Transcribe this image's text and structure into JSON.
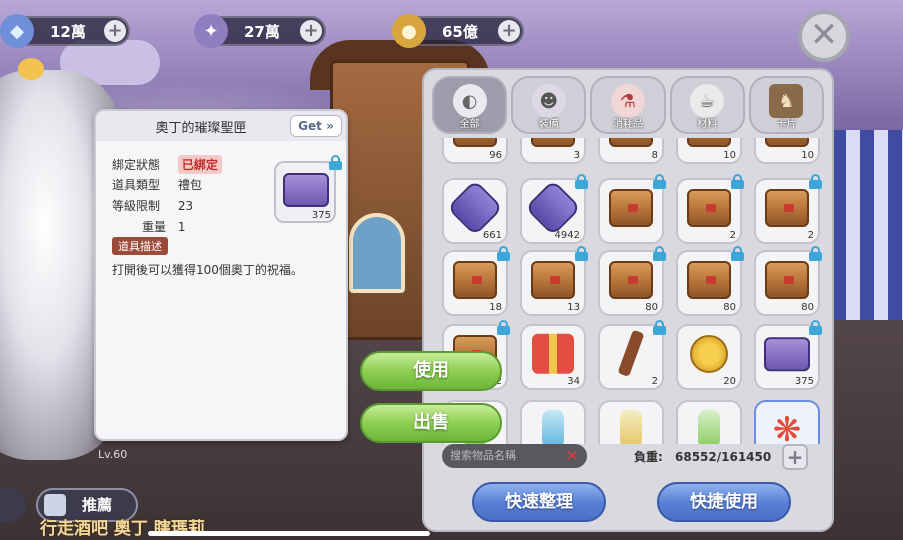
{
  "currencies": [
    {
      "icon": "diamond-icon",
      "value": "12萬"
    },
    {
      "icon": "feather-icon",
      "value": "27萬"
    },
    {
      "icon": "coin-icon",
      "value": "65億"
    }
  ],
  "tabs": [
    {
      "label": "全部",
      "icon": "all-icon",
      "active": true
    },
    {
      "label": "裝備",
      "icon": "equipment-icon",
      "active": false
    },
    {
      "label": "消耗品",
      "icon": "potion-icon",
      "active": false
    },
    {
      "label": "材料",
      "icon": "material-icon",
      "active": false
    },
    {
      "label": "卡片",
      "icon": "card-icon",
      "active": false
    }
  ],
  "inventory_rows": [
    [
      {
        "item": "partial-top",
        "qty": "96",
        "locked": false
      },
      {
        "item": "partial-top",
        "qty": "3",
        "locked": false
      },
      {
        "item": "partial-top",
        "qty": "8",
        "locked": false
      },
      {
        "item": "partial-top",
        "qty": "10",
        "locked": false
      },
      {
        "item": "partial-top",
        "qty": "10",
        "locked": false
      }
    ],
    [
      {
        "item": "purple-hexagon",
        "qty": "661",
        "locked": false
      },
      {
        "item": "purple-hexagon",
        "qty": "4942",
        "locked": true
      },
      {
        "item": "chest",
        "qty": "",
        "locked": true
      },
      {
        "item": "chest",
        "qty": "2",
        "locked": true
      },
      {
        "item": "chest",
        "qty": "2",
        "locked": true
      }
    ],
    [
      {
        "item": "chest",
        "qty": "18",
        "locked": true
      },
      {
        "item": "chest",
        "qty": "13",
        "locked": true
      },
      {
        "item": "chest",
        "qty": "80",
        "locked": true
      },
      {
        "item": "chest",
        "qty": "80",
        "locked": true
      },
      {
        "item": "chest",
        "qty": "80",
        "locked": true
      }
    ],
    [
      {
        "item": "chest",
        "qty": "2",
        "locked": true
      },
      {
        "item": "gift-box",
        "qty": "34",
        "locked": false
      },
      {
        "item": "branch",
        "qty": "2",
        "locked": true
      },
      {
        "item": "gold-coin",
        "qty": "20",
        "locked": false
      },
      {
        "item": "purple-chest",
        "qty": "375",
        "locked": true
      }
    ],
    [
      {
        "item": "bottle-green",
        "qty": "",
        "locked": false
      },
      {
        "item": "bottle-blue",
        "qty": "",
        "locked": false
      },
      {
        "item": "bottle-yellow",
        "qty": "",
        "locked": false
      },
      {
        "item": "bottle-green",
        "qty": "",
        "locked": false
      },
      {
        "item": "flame",
        "qty": "",
        "locked": false
      }
    ]
  ],
  "search": {
    "placeholder": "搜索物品名稱"
  },
  "weight": {
    "label": "負重:",
    "value": "68552/161450"
  },
  "buttons": {
    "sort": "快速整理",
    "quick_use": "快捷使用",
    "use": "使用",
    "sell": "出售"
  },
  "detail": {
    "title": "奧丁的璀璨聖匣",
    "get": "Get »",
    "bind_label": "綁定狀態",
    "bind_value": "已綁定",
    "type_label": "道具類型",
    "type_value": "禮包",
    "level_label": "等級限制",
    "level_value": "23",
    "weight_label": "重量",
    "weight_value": "1",
    "thumb_qty": "375",
    "desc_label": "道具描述",
    "desc_text": "打開後可以獲得100個奧丁的祝福。"
  },
  "level": "Lv.60",
  "recommend": "推薦",
  "ticker": "行走酒吧 奧丁 瞎瑪莉"
}
